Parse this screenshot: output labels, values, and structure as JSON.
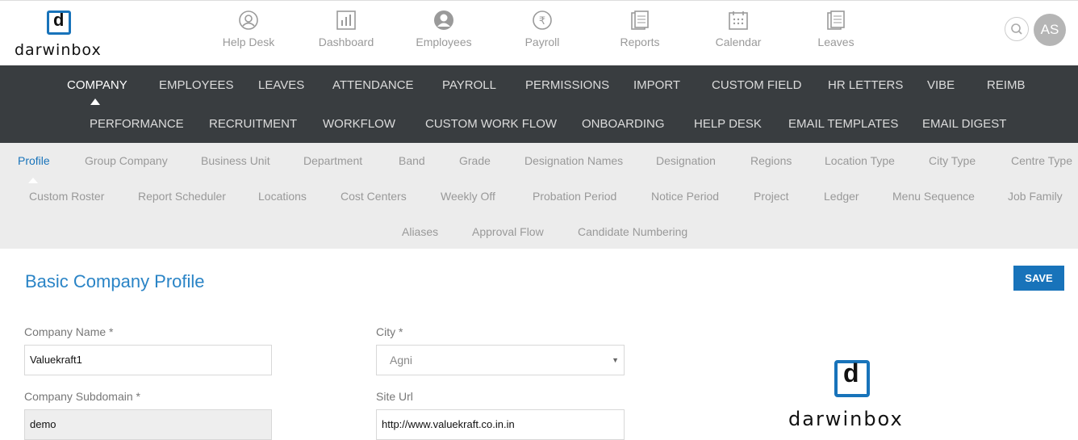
{
  "brand": {
    "logo_glyph": "d",
    "name": "darwinbox",
    "accent": "#1873ba"
  },
  "top_nav": [
    {
      "label": "Help Desk",
      "icon": "help-desk-icon"
    },
    {
      "label": "Dashboard",
      "icon": "dashboard-icon"
    },
    {
      "label": "Employees",
      "icon": "employees-icon"
    },
    {
      "label": "Payroll",
      "icon": "payroll-icon"
    },
    {
      "label": "Reports",
      "icon": "reports-icon"
    },
    {
      "label": "Calendar",
      "icon": "calendar-icon"
    },
    {
      "label": "Leaves",
      "icon": "leaves-icon"
    }
  ],
  "user": {
    "initials": "AS"
  },
  "main_nav": {
    "row1": [
      "COMPANY",
      "EMPLOYEES",
      "LEAVES",
      "ATTENDANCE",
      "PAYROLL",
      "PERMISSIONS",
      "IMPORT",
      "CUSTOM FIELD",
      "HR LETTERS",
      "VIBE",
      "REIMB"
    ],
    "row2": [
      "PERFORMANCE",
      "RECRUITMENT",
      "WORKFLOW",
      "CUSTOM WORK FLOW",
      "ONBOARDING",
      "HELP DESK",
      "EMAIL TEMPLATES",
      "EMAIL DIGEST"
    ],
    "active": "COMPANY"
  },
  "sub_nav": {
    "row1": [
      "Profile",
      "Group Company",
      "Business Unit",
      "Department",
      "Band",
      "Grade",
      "Designation Names",
      "Designation",
      "Regions",
      "Location Type",
      "City Type",
      "Centre Type"
    ],
    "row2": [
      "Custom Roster",
      "Report Scheduler",
      "Locations",
      "Cost Centers",
      "Weekly Off",
      "Probation Period",
      "Notice Period",
      "Project",
      "Ledger",
      "Menu Sequence",
      "Job Family"
    ],
    "row3": [
      "Aliases",
      "Approval Flow",
      "Candidate Numbering"
    ],
    "active": "Profile"
  },
  "page": {
    "title": "Basic Company Profile",
    "save_label": "SAVE"
  },
  "form": {
    "company_name": {
      "label": "Company Name *",
      "value": "Valuekraft1"
    },
    "company_subdomain": {
      "label": "Company Subdomain *",
      "value": "demo"
    },
    "city": {
      "label": "City *",
      "value": "Agni"
    },
    "site_url": {
      "label": "Site Url",
      "value": "http://www.valuekraft.co.in.in"
    }
  },
  "company_logo": {
    "glyph": "d",
    "name": "darwinbox"
  }
}
